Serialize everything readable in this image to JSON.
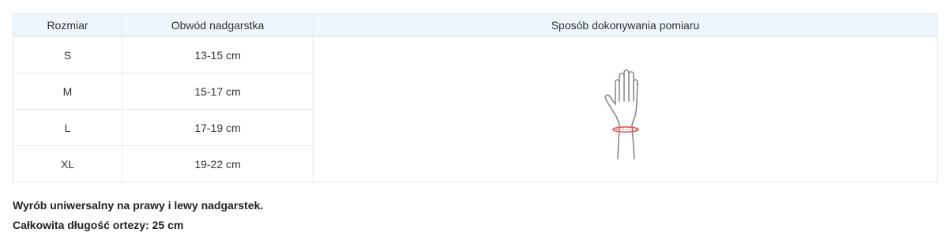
{
  "table": {
    "headers": [
      "Rozmiar",
      "Obwód nadgarstka",
      "Sposób dokonywania pomiaru"
    ],
    "rows": [
      {
        "size": "S",
        "circumference": "13-15 cm"
      },
      {
        "size": "M",
        "circumference": "15-17 cm"
      },
      {
        "size": "L",
        "circumference": "17-19 cm"
      },
      {
        "size": "XL",
        "circumference": "19-22 cm"
      }
    ],
    "illustration": "hand-wrist-measurement-icon"
  },
  "notes": {
    "line1": "Wyrób uniwersalny na prawy i lewy nadgarstek.",
    "line2": "Całkowita długość ortezy: 25 cm"
  },
  "colors": {
    "header_bg": "#eef5fb",
    "border": "#e3e7ec",
    "measure_line": "#e0585a",
    "hand_outline": "#8a8a8a"
  }
}
